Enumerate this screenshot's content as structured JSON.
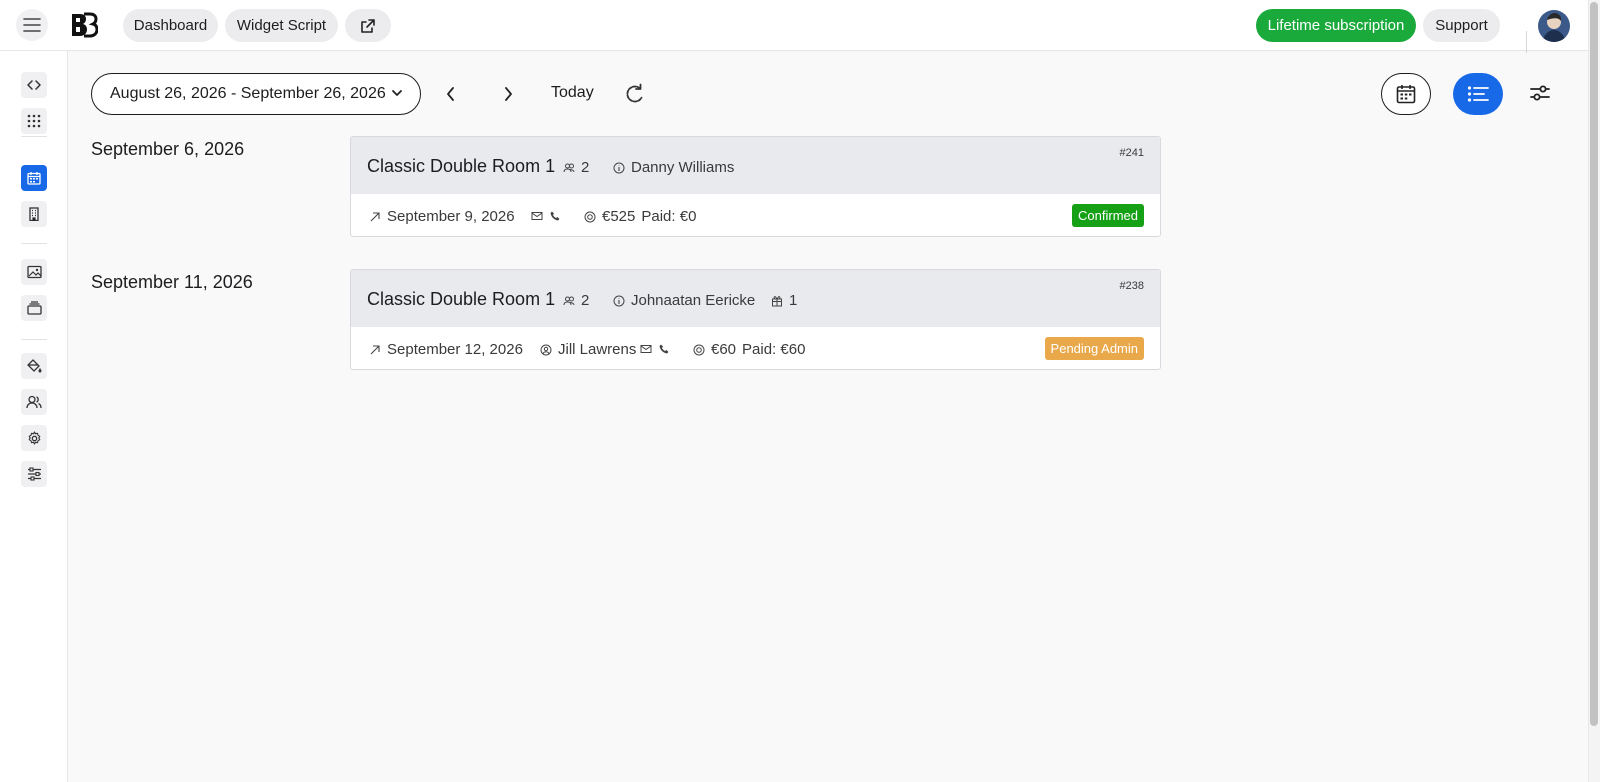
{
  "topbar": {
    "dashboard_label": "Dashboard",
    "widget_script_label": "Widget Script",
    "lifetime_label": "Lifetime subscription",
    "support_label": "Support"
  },
  "toolbar": {
    "date_range": "August 26, 2026 - September 26, 2026",
    "today_label": "Today"
  },
  "colors": {
    "accent": "#1869e8",
    "success": "#1aaa3c",
    "confirmed": "#16a016",
    "pending": "#e9a84a"
  },
  "groups": [
    {
      "date": "September 6, 2026",
      "booking": {
        "room": "Classic Double Room 1",
        "guests": "2",
        "name": "Danny Williams",
        "ref": "#241",
        "checkout": "September 9, 2026",
        "price": "€525",
        "paid": "Paid: €0",
        "status": "Confirmed"
      }
    },
    {
      "date": "September 11, 2026",
      "booking": {
        "room": "Classic Double Room 1",
        "guests": "2",
        "name": "Johnaatan Eericke",
        "extra": "1",
        "ref": "#238",
        "checkout": "September 12, 2026",
        "contact": "Jill Lawrens",
        "price": "€60",
        "paid": "Paid: €60",
        "status": "Pending Admin"
      }
    }
  ]
}
